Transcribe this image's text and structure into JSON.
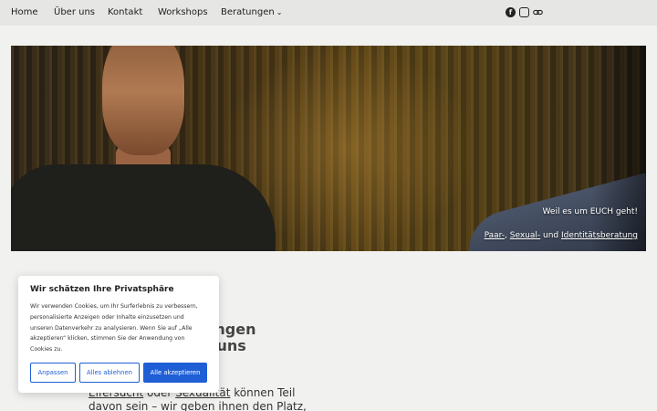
{
  "nav": {
    "items": [
      {
        "label": "Home"
      },
      {
        "label": "Über uns"
      },
      {
        "label": "Kontakt"
      },
      {
        "label": "Workshops"
      },
      {
        "label": "Beratungen"
      }
    ],
    "chevron": "⌄"
  },
  "social": {
    "facebook_icon": "f",
    "instagram_icon": "◎",
    "link_icon": "⛓"
  },
  "hero": {
    "tagline": "Weil es um EUCH geht!",
    "services": {
      "paar": "Paar-",
      "sep1": ", ",
      "sexual": "Sexual-",
      "sep2": " und ",
      "identitaet": "Identitätsberatung"
    }
  },
  "content": {
    "heading_line1": "ungen",
    "heading_line2": "r uns",
    "heading_line3": "n.",
    "body_word1": "Eifersucht",
    "body_mid": " oder ",
    "body_word2": "Sexualität",
    "body_rest": " können Teil",
    "body_line2": "davon sein – wir geben ihnen den Platz, den"
  },
  "cookie": {
    "title": "Wir schätzen Ihre Privatsphäre",
    "text": "Wir verwenden Cookies, um Ihr Surferlebnis zu verbessern, personalisierte Anzeigen oder Inhalte einzusetzen und unseren Datenverkehr zu analysieren. Wenn Sie auf „Alle akzeptieren“ klicken, stimmen Sie der Anwendung von Cookies zu.",
    "btn_customize": "Anpassen",
    "btn_reject": "Alles ablehnen",
    "btn_accept": "Alle akzeptieren"
  },
  "colors": {
    "accent": "#1f5fd6",
    "nav_bg": "#e6e6e4",
    "page_bg": "#f1f1ef"
  }
}
